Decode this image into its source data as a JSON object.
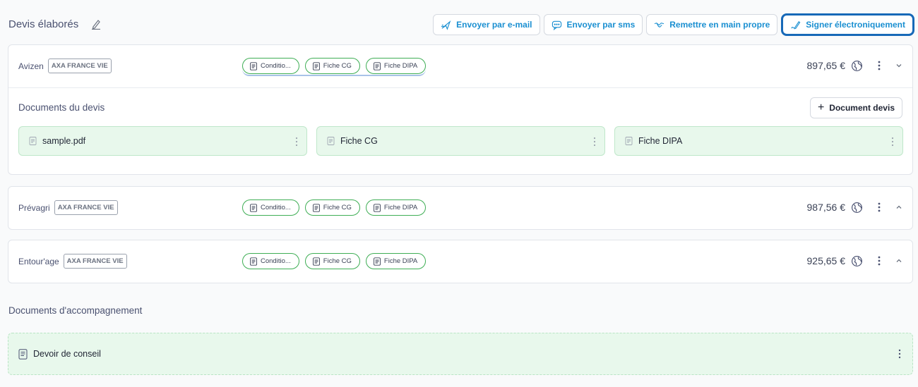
{
  "header": {
    "title": "Devis élaborés",
    "actions": [
      {
        "label": "Envoyer par e-mail",
        "icon": "send-icon"
      },
      {
        "label": "Envoyer par sms",
        "icon": "sms-icon"
      },
      {
        "label": "Remettre en main propre",
        "icon": "handshake-icon"
      },
      {
        "label": "Signer électroniquement",
        "icon": "signature-icon"
      }
    ]
  },
  "quotes": [
    {
      "product": "Avizen",
      "company": "AXA FRANCE VIE",
      "chips": [
        "Conditio...",
        "Fiche CG",
        "Fiche DIPA"
      ],
      "price": "897,65 €",
      "expanded": true,
      "documents_title": "Documents du devis",
      "add_document_label": "Document devis",
      "documents": [
        "sample.pdf",
        "Fiche CG",
        "Fiche DIPA"
      ]
    },
    {
      "product": "Prévagri",
      "company": "AXA FRANCE VIE",
      "chips": [
        "Conditio...",
        "Fiche CG",
        "Fiche DIPA"
      ],
      "price": "987,56 €",
      "expanded": false
    },
    {
      "product": "Entour'age",
      "company": "AXA FRANCE VIE",
      "chips": [
        "Conditio...",
        "Fiche CG",
        "Fiche DIPA"
      ],
      "price": "925,65 €",
      "expanded": false
    }
  ],
  "accompaniment": {
    "title": "Documents d'accompagnement",
    "documents": [
      "Devoir de conseil"
    ]
  },
  "colors": {
    "accent": "#1a8fd1",
    "focus": "#1769b8",
    "chip_border": "#3fae55",
    "doc_bg": "#e8f8ec"
  }
}
